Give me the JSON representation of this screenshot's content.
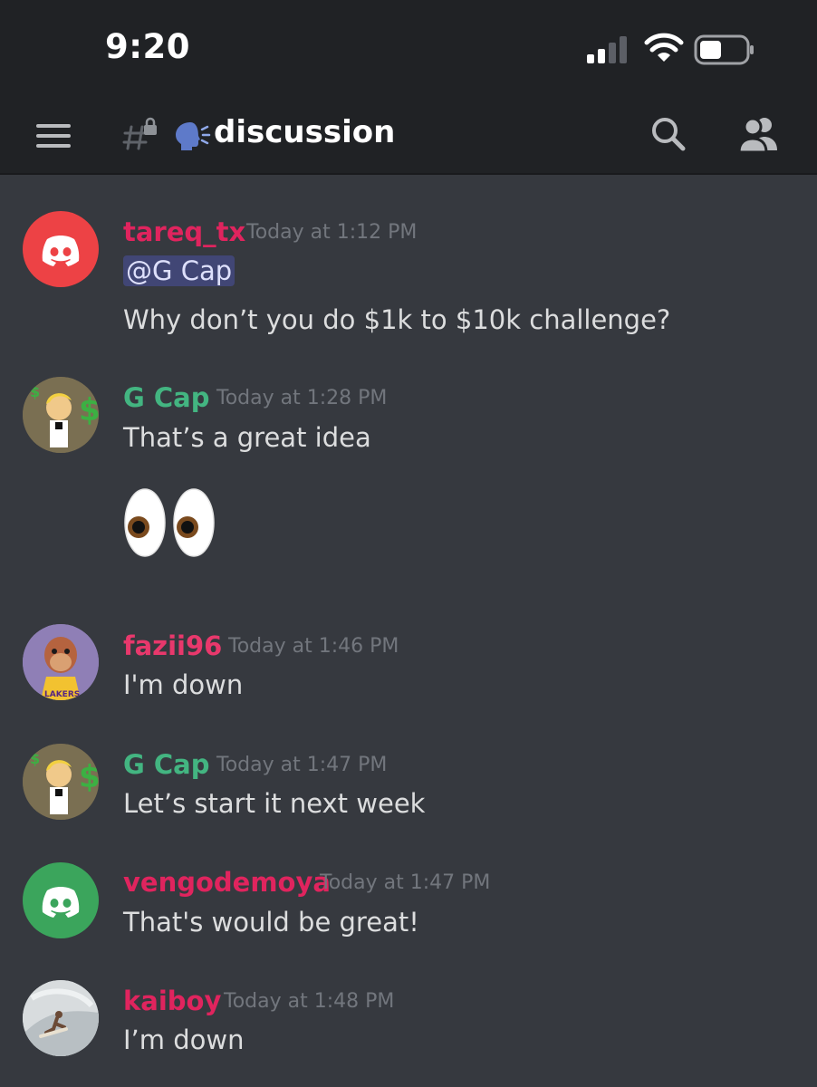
{
  "status_bar": {
    "time": "9:20"
  },
  "header": {
    "channel_emoji": "🗣",
    "channel_name": "discussion"
  },
  "messages": [
    {
      "author": "tareq_tx",
      "timestamp": "Today at 1:12 PM",
      "mention": "@G Cap",
      "text": "Why don’t you do $1k to $10k challenge?"
    },
    {
      "author": "G Cap",
      "timestamp": "Today at 1:28 PM",
      "text": "That’s a great idea",
      "emoji": "👀"
    },
    {
      "author": "fazii96",
      "timestamp": "Today at 1:46 PM",
      "text": "I'm down",
      "avatar_text": "LAKERS"
    },
    {
      "author": "G Cap",
      "timestamp": "Today at 1:47 PM",
      "text": "Let’s start it next week"
    },
    {
      "author": "vengodemoya",
      "timestamp": "Today at 1:47 PM",
      "text": "That's would be great!"
    },
    {
      "author": "kaiboy",
      "timestamp": "Today at 1:48 PM",
      "text": "I’m down"
    }
  ],
  "colors": {
    "background": "#36393f",
    "header": "#202225",
    "author_red": "#e0245e",
    "author_green": "#43b581",
    "mention_bg": "#414675",
    "discord_red": "#ed4245",
    "discord_green": "#3ba55c"
  }
}
